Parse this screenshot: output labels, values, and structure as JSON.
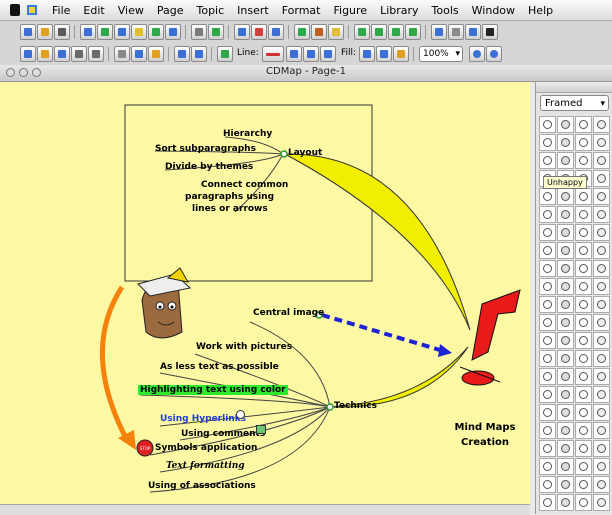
{
  "menu": [
    "File",
    "Edit",
    "View",
    "Page",
    "Topic",
    "Insert",
    "Format",
    "Figure",
    "Library",
    "Tools",
    "Window",
    "Help"
  ],
  "toolbar2": {
    "line_label": "Line:",
    "fill_label": "Fill:",
    "zoom_value": "100%"
  },
  "window": {
    "title": "CDMap - Page-1"
  },
  "palette": {
    "selected": "Framed",
    "tooltip": "Unhappy"
  },
  "map": {
    "layout_label": "Layout",
    "layout_items": [
      "Hierarchy",
      "Sort subparagraphs",
      "Divide by themes",
      "Connect common",
      "paragraphs using",
      "lines or arrows"
    ],
    "central_image_label": "Central image",
    "technics_label": "Technics",
    "technics_items": [
      "Work with pictures",
      "As less text as possible",
      "Highlighting text using color",
      "Using Hyperlinks",
      "Using comments",
      "Symbols application",
      "Text formatting",
      "Using of associations"
    ],
    "center_line1": "Mind Maps",
    "center_line2": "Creation",
    "stop_sign": "STOP"
  },
  "colors": {
    "canvas": "#fcf8a4",
    "highlight": "#2ee82e",
    "hyperlink": "#1d3fd6",
    "arrow_orange": "#f5820a",
    "arrow_blue": "#1d22d6",
    "center_red": "#e81a1a"
  }
}
